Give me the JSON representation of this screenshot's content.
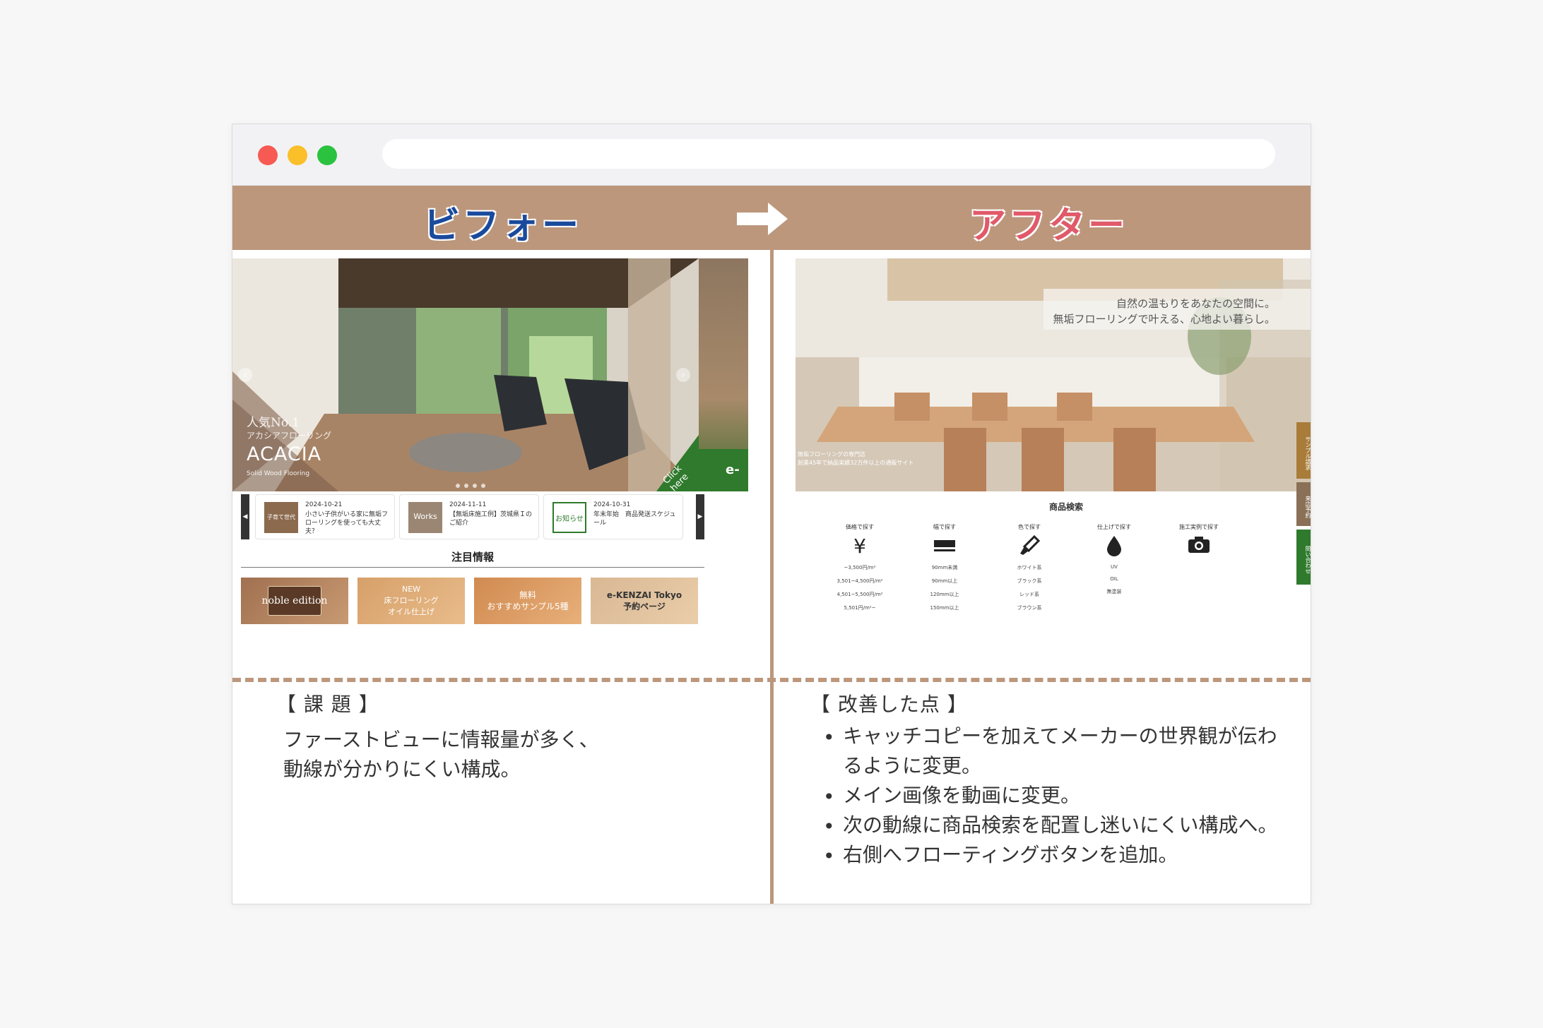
{
  "banner": {
    "before": "ビフォー",
    "after": "アフター"
  },
  "before_site": {
    "hero": {
      "tag_line1": "人気No.1",
      "tag_line2": "アカシアフローリング",
      "product": "ACACIA",
      "subtitle": "Solid Wood Flooring",
      "badge": "Click here",
      "next_logo": "e-"
    },
    "news": [
      {
        "date": "2024-10-21",
        "thumb_label": "子育て世代",
        "text": "小さい子供がいる家に無垢フローリングを使っても大丈夫？"
      },
      {
        "date": "2024-11-11",
        "thumb_label": "Works",
        "text": "【無垢床施工例】茨城県Ｉのご紹介"
      },
      {
        "date": "2024-10-31",
        "thumb_label": "お知らせ",
        "text": "年末年始　商品発送スケジュール"
      }
    ],
    "attention_title": "注目情報",
    "thumbs": [
      {
        "label": "noble edition"
      },
      {
        "label": "NEW\n床フローリング\nオイル仕上げ"
      },
      {
        "label": "無料\nおすすめサンプル5種"
      },
      {
        "label": "e-KENZAI Tokyo\n予約ページ"
      }
    ]
  },
  "after_site": {
    "catch1": "自然の温もりをあなたの空間に。",
    "catch2": "無垢フローリングで叶える、心地よい暮らし。",
    "small1": "無垢フローリングの専門店",
    "small2": "創業45年で納品実績32万件以上の通販サイト",
    "floating_buttons": [
      "サンプル請求",
      "来店予約",
      "問い合わせ"
    ],
    "search_title": "商品検索",
    "search_columns": [
      {
        "head": "価格で探す",
        "icon": "yen-icon",
        "items": [
          "~3,500円/m²",
          "3,501~4,500円/m²",
          "4,501~5,500円/m²",
          "5,501円/m²~"
        ]
      },
      {
        "head": "幅で探す",
        "icon": "width-icon",
        "items": [
          "90mm未満",
          "90mm以上",
          "120mm以上",
          "150mm以上"
        ]
      },
      {
        "head": "色で探す",
        "icon": "brush-icon",
        "items": [
          "ホワイト系",
          "ブラック系",
          "レッド系",
          "ブラウン系"
        ]
      },
      {
        "head": "仕上げで探す",
        "icon": "drop-icon",
        "items": [
          "UV",
          "OIL",
          "無塗装"
        ]
      },
      {
        "head": "施工実例で探す",
        "icon": "camera-icon",
        "items": []
      }
    ]
  },
  "notes": {
    "issue_heading": "【 課 題 】",
    "issue_line1": "ファーストビューに情報量が多く、",
    "issue_line2": "動線が分かりにくい構成。",
    "improve_heading": "【 改善した点 】",
    "improvements": [
      "キャッチコピーを加えてメーカーの世界観が伝わ",
      "るように変更。",
      "メイン画像を動画に変更。",
      "次の動線に商品検索を配置し迷いにくい構成へ。",
      "右側へフローティングボタンを追加。"
    ]
  },
  "colors": {
    "accent": "#bc977c",
    "before_label": "#1a4a9c",
    "after_label": "#e05a6a",
    "float_sample": "#a97c3a",
    "float_visit": "#8a7056",
    "float_contact": "#2f7a2c"
  }
}
